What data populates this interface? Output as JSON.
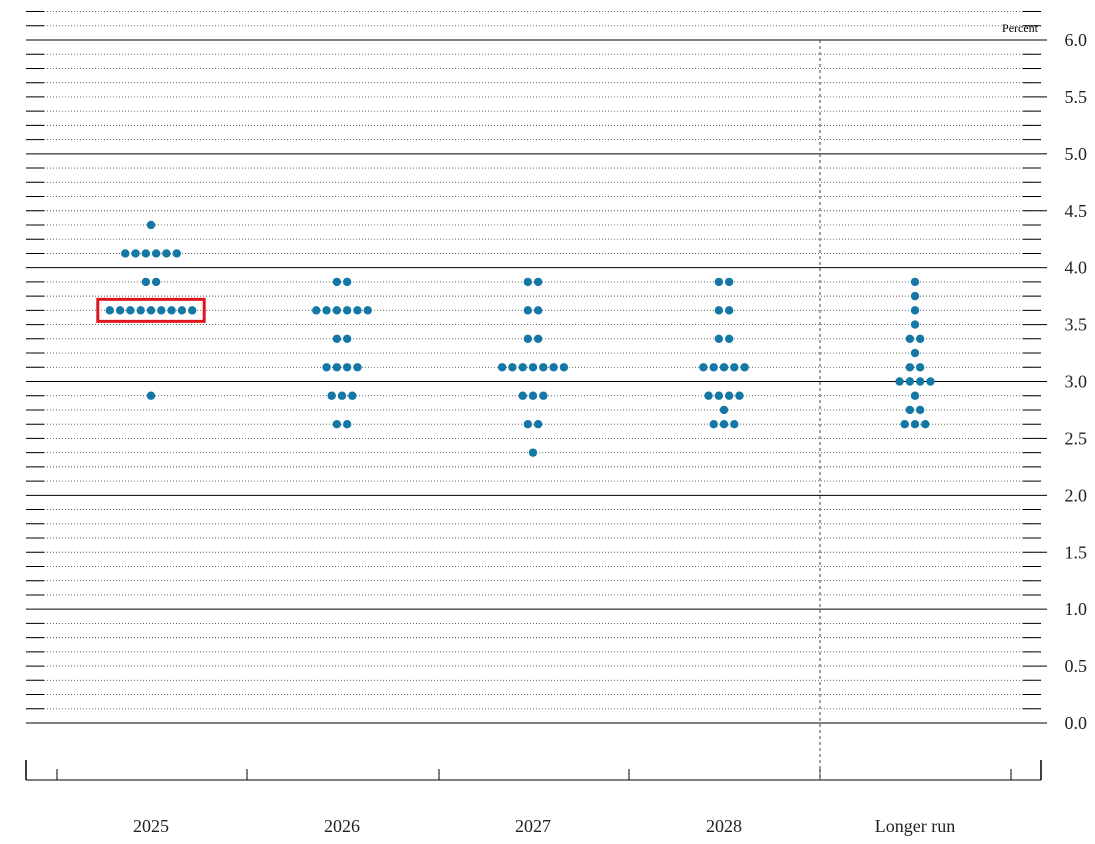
{
  "chart_data": {
    "type": "scatter",
    "subtype": "dot-plot",
    "y_unit_label": "Percent",
    "ylim": [
      0.0,
      6.0
    ],
    "yticks": [
      "6.0",
      "5.5",
      "5.0",
      "4.5",
      "4.0",
      "3.5",
      "3.0",
      "2.5",
      "2.0",
      "1.5",
      "1.0",
      "0.5",
      "0.0"
    ],
    "categories": [
      "2025",
      "2026",
      "2027",
      "2028",
      "Longer run"
    ],
    "grid": "solid at whole percents, dotted at eighths",
    "dot_color": "#1478a6",
    "highlight_color": "#e0141c",
    "highlight": {
      "category": "2025",
      "value": 3.625,
      "count": 9
    },
    "dots": [
      {
        "category": "2025",
        "points": [
          {
            "value": 4.375,
            "count": 1
          },
          {
            "value": 4.125,
            "count": 6
          },
          {
            "value": 3.875,
            "count": 2
          },
          {
            "value": 3.625,
            "count": 9
          },
          {
            "value": 2.875,
            "count": 1
          }
        ]
      },
      {
        "category": "2026",
        "points": [
          {
            "value": 3.875,
            "count": 2
          },
          {
            "value": 3.625,
            "count": 6
          },
          {
            "value": 3.375,
            "count": 2
          },
          {
            "value": 3.125,
            "count": 4
          },
          {
            "value": 2.875,
            "count": 3
          },
          {
            "value": 2.625,
            "count": 2
          }
        ]
      },
      {
        "category": "2027",
        "points": [
          {
            "value": 3.875,
            "count": 2
          },
          {
            "value": 3.625,
            "count": 2
          },
          {
            "value": 3.375,
            "count": 2
          },
          {
            "value": 3.125,
            "count": 7
          },
          {
            "value": 2.875,
            "count": 3
          },
          {
            "value": 2.625,
            "count": 2
          },
          {
            "value": 2.375,
            "count": 1
          }
        ]
      },
      {
        "category": "2028",
        "points": [
          {
            "value": 3.875,
            "count": 2
          },
          {
            "value": 3.625,
            "count": 2
          },
          {
            "value": 3.375,
            "count": 2
          },
          {
            "value": 3.125,
            "count": 5
          },
          {
            "value": 2.875,
            "count": 4
          },
          {
            "value": 2.75,
            "count": 1
          },
          {
            "value": 2.625,
            "count": 3
          }
        ]
      },
      {
        "category": "Longer run",
        "points": [
          {
            "value": 3.875,
            "count": 1
          },
          {
            "value": 3.75,
            "count": 1
          },
          {
            "value": 3.625,
            "count": 1
          },
          {
            "value": 3.5,
            "count": 1
          },
          {
            "value": 3.375,
            "count": 2
          },
          {
            "value": 3.25,
            "count": 1
          },
          {
            "value": 3.125,
            "count": 2
          },
          {
            "value": 3.0,
            "count": 4
          },
          {
            "value": 2.875,
            "count": 1
          },
          {
            "value": 2.75,
            "count": 2
          },
          {
            "value": 2.625,
            "count": 3
          }
        ]
      }
    ]
  }
}
